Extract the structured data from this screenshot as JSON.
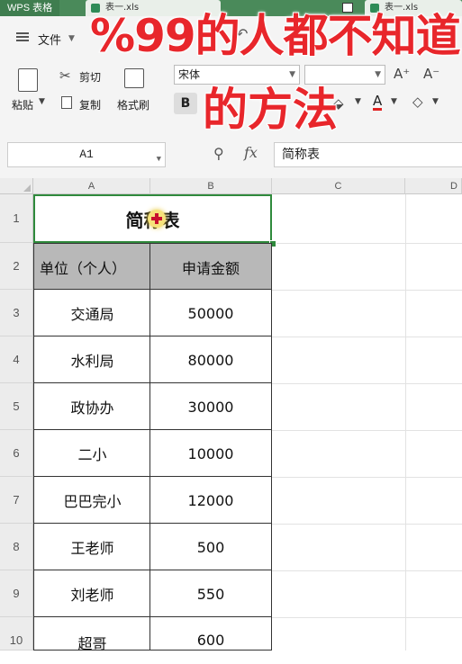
{
  "app": {
    "title": "WPS 表格"
  },
  "tabs": [
    {
      "label": "表一.xls"
    },
    {
      "label": "表一.xls"
    }
  ],
  "menu": {
    "file_label": "文件"
  },
  "ribbon": {
    "paste_label": "粘贴",
    "cut_label": "剪切",
    "copy_label": "复制",
    "format_painter_label": "格式刷",
    "font_name": "宋体",
    "bold_label": "B"
  },
  "caption": {
    "line1": "%99的人都不知道",
    "line2": "的方法"
  },
  "formula_bar": {
    "cell_ref": "A1",
    "fx_label": "fx",
    "content": "简称表"
  },
  "sheet": {
    "columns": [
      "A",
      "B",
      "C",
      "D"
    ],
    "rows": [
      "1",
      "2",
      "3",
      "4",
      "5",
      "6",
      "7",
      "8",
      "9",
      "10"
    ],
    "title": "简称表",
    "header": [
      "单位（个人）",
      "申请金额"
    ],
    "data": [
      [
        "交通局",
        "50000"
      ],
      [
        "水利局",
        "80000"
      ],
      [
        "政协办",
        "30000"
      ],
      [
        "二小",
        "10000"
      ],
      [
        "巴巴完小",
        "12000"
      ],
      [
        "王老师",
        "500"
      ],
      [
        "刘老师",
        "550"
      ],
      [
        "超哥",
        "600"
      ]
    ]
  },
  "colors": {
    "accent": "#2f8a3c",
    "caption": "#e8262b",
    "header_fill": "#b8b8b8"
  }
}
